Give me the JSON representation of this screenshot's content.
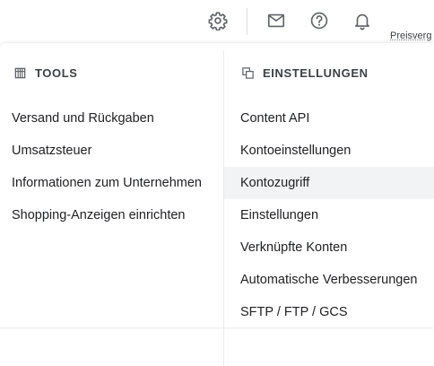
{
  "toolbar": {
    "icons": [
      "gear-icon",
      "mail-icon",
      "help-icon",
      "bell-icon"
    ],
    "cut_text": "Preisverg"
  },
  "tools": {
    "icon": "tools-icon",
    "title": "TOOLS",
    "items": [
      "Versand und Rückgaben",
      "Umsatzsteuer",
      "Informationen zum Unternehmen",
      "Shopping-Anzeigen einrichten"
    ]
  },
  "settings": {
    "icon": "settings-copy-icon",
    "title": "EINSTELLUNGEN",
    "items": [
      "Content API",
      "Kontoeinstellungen",
      "Kontozugriff",
      "Einstellungen",
      "Verknüpfte Konten",
      "Automatische Verbesserungen",
      "SFTP / FTP / GCS"
    ],
    "active_item": "Kontozugriff"
  },
  "colors": {
    "text": "#202124",
    "header_text": "#3c4043",
    "icon": "#5f6368",
    "active_bg": "#f1f3f4",
    "divider": "#e8eaed"
  }
}
